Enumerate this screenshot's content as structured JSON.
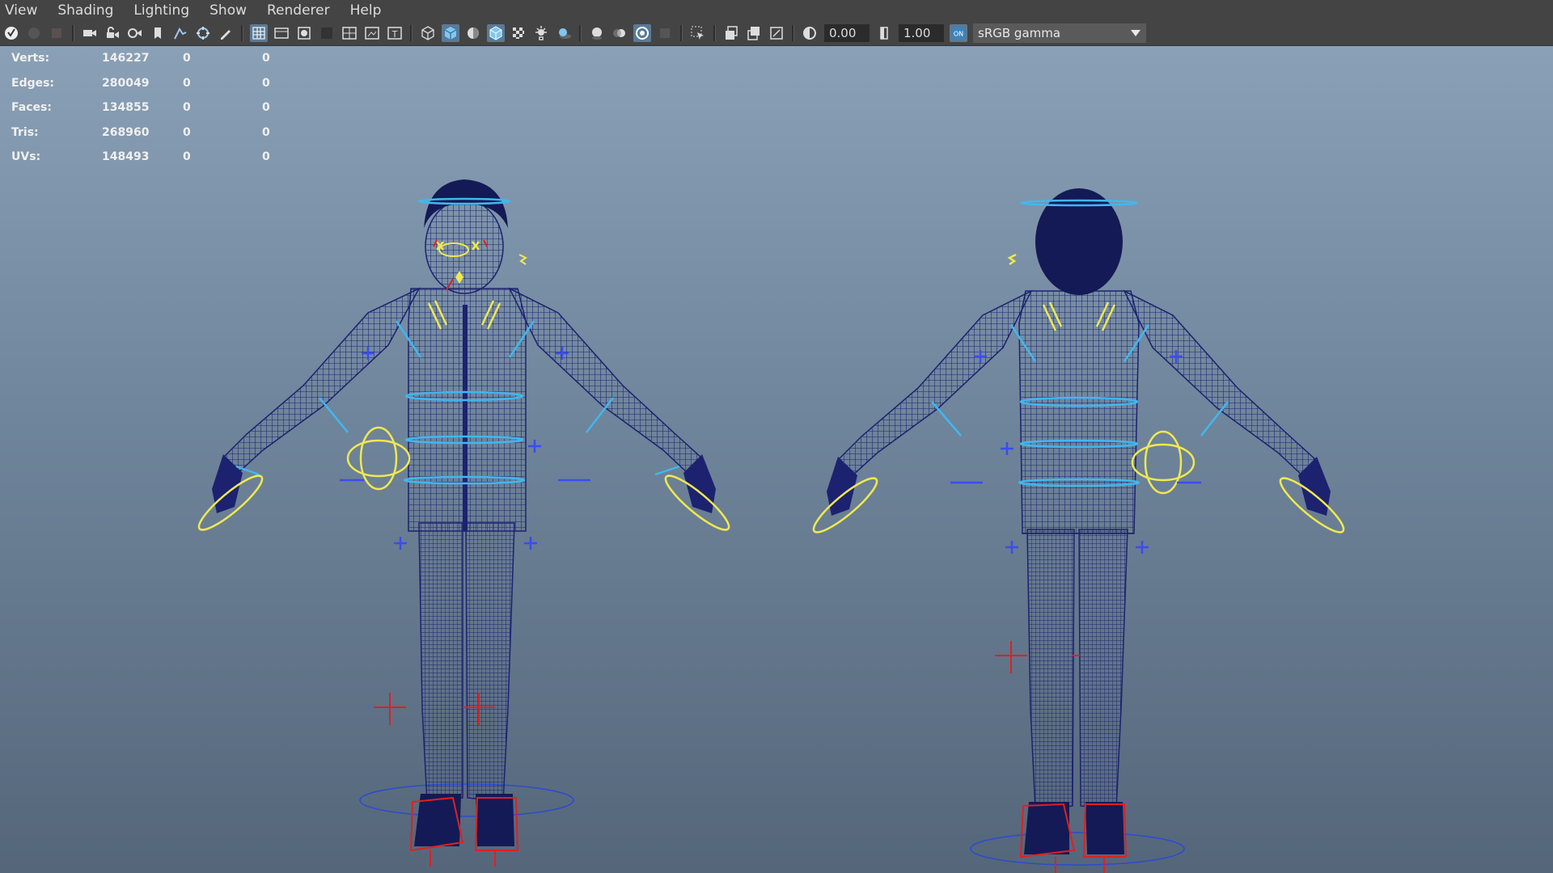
{
  "menubar": {
    "items": [
      "View",
      "Shading",
      "Lighting",
      "Show",
      "Renderer",
      "Help"
    ]
  },
  "toolbar": {
    "exposure_value": "0.00",
    "gamma_value": "1.00",
    "color_space": "sRGB gamma",
    "icons": [
      "select-camera-icon",
      "lock-camera-icon",
      "camera-attributes-icon",
      "bookmark-icon",
      "image-plane-icon",
      "2d-pan-zoom-icon",
      "grease-pencil-icon",
      "grid-icon",
      "film-gate-icon",
      "resolution-gate-icon",
      "gate-mask-icon",
      "field-chart-icon",
      "safe-action-icon",
      "safe-title-icon",
      "wireframe-icon",
      "smooth-shade-icon",
      "wireframe-on-shaded-icon",
      "textured-icon",
      "use-all-lights-icon",
      "shadows-icon",
      "screen-space-ao-icon",
      "motion-blur-icon",
      "anti-aliasing-icon",
      "depth-of-field-icon",
      "isolate-select-icon",
      "xray-icon",
      "xray-joints-icon",
      "backface-culling-icon",
      "exposure-icon",
      "gamma-icon",
      "color-management-icon"
    ]
  },
  "hud": {
    "rows": [
      {
        "label": "Verts:",
        "value": "146227",
        "c1": "0",
        "c2": "0"
      },
      {
        "label": "Edges:",
        "value": "280049",
        "c1": "0",
        "c2": "0"
      },
      {
        "label": "Faces:",
        "value": "134855",
        "c1": "0",
        "c2": "0"
      },
      {
        "label": "Tris:",
        "value": "268960",
        "c1": "0",
        "c2": "0"
      },
      {
        "label": "UVs:",
        "value": "148493",
        "c1": "0",
        "c2": "0"
      }
    ]
  },
  "colors": {
    "menubar_bg": "#444444",
    "mesh_wire": "#1c2270",
    "ctrl_cyan": "#3fb8f0",
    "ctrl_yellow": "#f0e850",
    "ctrl_blue": "#3a4cf0",
    "ctrl_red": "#e02020"
  }
}
